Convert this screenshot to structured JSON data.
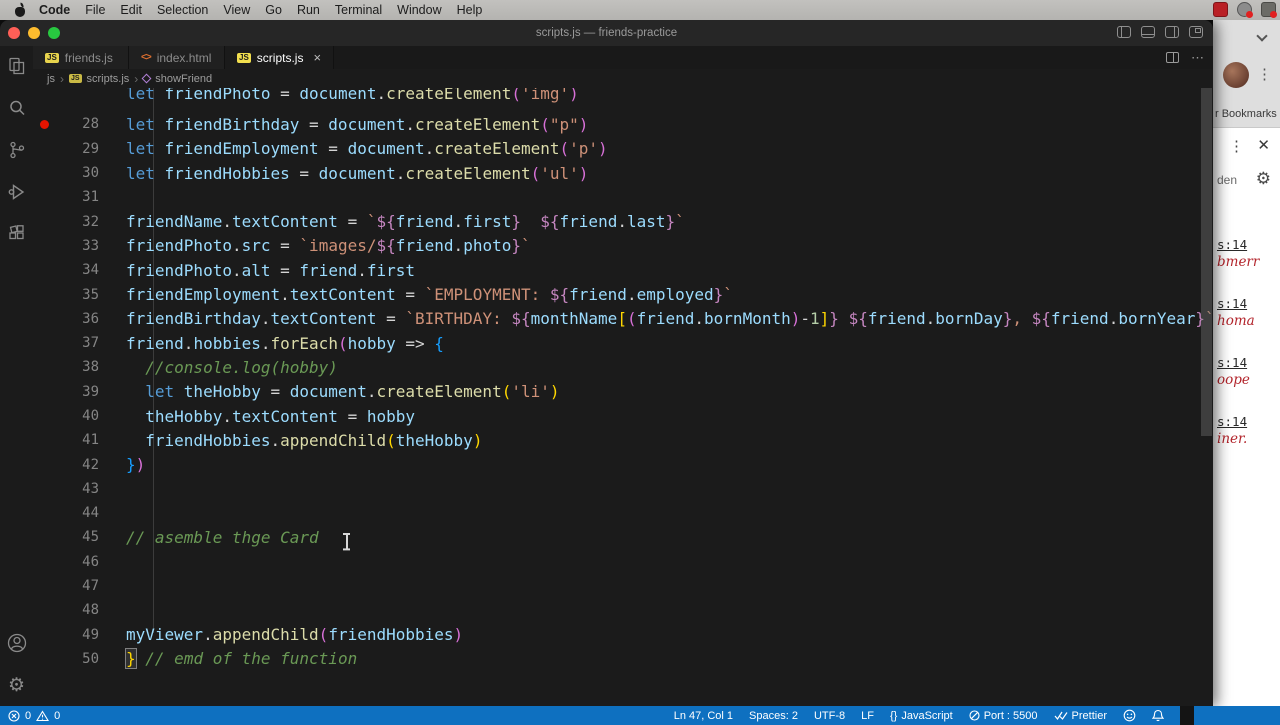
{
  "menubar": {
    "items": [
      "Code",
      "File",
      "Edit",
      "Selection",
      "View",
      "Go",
      "Run",
      "Terminal",
      "Window",
      "Help"
    ],
    "bold_item": "Code"
  },
  "window": {
    "title": "scripts.js — friends-practice"
  },
  "icons": {
    "js_badge": "JS",
    "html_badge": "<>",
    "more_glyph": "⋯",
    "gear_glyph": "⚙",
    "kebab_glyph": "⋮",
    "close_glyph": "✕",
    "tab_close_glyph": "×",
    "breadcrumb_separator": "›",
    "language_icon": "{}"
  },
  "tabs": [
    {
      "label": "friends.js",
      "icon": "js",
      "active": false
    },
    {
      "label": "index.html",
      "icon": "html",
      "active": false
    },
    {
      "label": "scripts.js",
      "icon": "js",
      "active": true,
      "closable": true
    }
  ],
  "breadcrumb": {
    "segments": [
      "js",
      "scripts.js",
      "showFriend"
    ]
  },
  "editor": {
    "partial_line": {
      "t": [
        [
          "kw",
          "let "
        ],
        [
          "var",
          "friendPhoto"
        ],
        [
          "op",
          " = "
        ],
        [
          "var",
          "document"
        ],
        [
          "op",
          "."
        ],
        [
          "fn",
          "createElement"
        ],
        [
          "b2",
          "("
        ],
        [
          "str",
          "'img'"
        ],
        [
          "b2",
          ")"
        ]
      ]
    },
    "lines": [
      {
        "n": 28,
        "bp": true,
        "t": [
          [
            "kw",
            "let "
          ],
          [
            "var",
            "friendBirthday"
          ],
          [
            "op",
            " = "
          ],
          [
            "var",
            "document"
          ],
          [
            "op",
            "."
          ],
          [
            "fn",
            "createElement"
          ],
          [
            "b2",
            "("
          ],
          [
            "str",
            "\"p\""
          ],
          [
            "b2",
            ")"
          ]
        ]
      },
      {
        "n": 29,
        "t": [
          [
            "kw",
            "let "
          ],
          [
            "var",
            "friendEmployment"
          ],
          [
            "op",
            " = "
          ],
          [
            "var",
            "document"
          ],
          [
            "op",
            "."
          ],
          [
            "fn",
            "createElement"
          ],
          [
            "b2",
            "("
          ],
          [
            "str",
            "'p'"
          ],
          [
            "b2",
            ")"
          ]
        ]
      },
      {
        "n": 30,
        "t": [
          [
            "kw",
            "let "
          ],
          [
            "var",
            "friendHobbies"
          ],
          [
            "op",
            " = "
          ],
          [
            "var",
            "document"
          ],
          [
            "op",
            "."
          ],
          [
            "fn",
            "createElement"
          ],
          [
            "b2",
            "("
          ],
          [
            "str",
            "'ul'"
          ],
          [
            "b2",
            ")"
          ]
        ]
      },
      {
        "n": 31,
        "t": []
      },
      {
        "n": 32,
        "t": [
          [
            "var",
            "friendName"
          ],
          [
            "op",
            "."
          ],
          [
            "var",
            "textContent"
          ],
          [
            "op",
            " = "
          ],
          [
            "str",
            "`"
          ],
          [
            "tpl",
            "${"
          ],
          [
            "var",
            "friend"
          ],
          [
            "op",
            "."
          ],
          [
            "var",
            "first"
          ],
          [
            "tpl",
            "}"
          ],
          [
            "str",
            "  "
          ],
          [
            "tpl",
            "${"
          ],
          [
            "var",
            "friend"
          ],
          [
            "op",
            "."
          ],
          [
            "var",
            "last"
          ],
          [
            "tpl",
            "}"
          ],
          [
            "str",
            "`"
          ]
        ]
      },
      {
        "n": 33,
        "t": [
          [
            "var",
            "friendPhoto"
          ],
          [
            "op",
            "."
          ],
          [
            "var",
            "src"
          ],
          [
            "op",
            " = "
          ],
          [
            "str",
            "`images/"
          ],
          [
            "tpl",
            "${"
          ],
          [
            "var",
            "friend"
          ],
          [
            "op",
            "."
          ],
          [
            "var",
            "photo"
          ],
          [
            "tpl",
            "}"
          ],
          [
            "str",
            "`"
          ]
        ]
      },
      {
        "n": 34,
        "t": [
          [
            "var",
            "friendPhoto"
          ],
          [
            "op",
            "."
          ],
          [
            "var",
            "alt"
          ],
          [
            "op",
            " = "
          ],
          [
            "var",
            "friend"
          ],
          [
            "op",
            "."
          ],
          [
            "var",
            "first"
          ]
        ]
      },
      {
        "n": 35,
        "t": [
          [
            "var",
            "friendEmployment"
          ],
          [
            "op",
            "."
          ],
          [
            "var",
            "textContent"
          ],
          [
            "op",
            " = "
          ],
          [
            "str",
            "`EMPLOYMENT: "
          ],
          [
            "tpl",
            "${"
          ],
          [
            "var",
            "friend"
          ],
          [
            "op",
            "."
          ],
          [
            "var",
            "employed"
          ],
          [
            "tpl",
            "}"
          ],
          [
            "str",
            "`"
          ]
        ]
      },
      {
        "n": 36,
        "t": [
          [
            "var",
            "friendBirthday"
          ],
          [
            "op",
            "."
          ],
          [
            "var",
            "textContent"
          ],
          [
            "op",
            " = "
          ],
          [
            "str",
            "`BIRTHDAY: "
          ],
          [
            "tpl",
            "${"
          ],
          [
            "var",
            "monthName"
          ],
          [
            "b1",
            "["
          ],
          [
            "b2",
            "("
          ],
          [
            "var",
            "friend"
          ],
          [
            "op",
            "."
          ],
          [
            "var",
            "bornMonth"
          ],
          [
            "b2",
            ")"
          ],
          [
            "op",
            "-"
          ],
          [
            "num",
            "1"
          ],
          [
            "b1",
            "]"
          ],
          [
            "tpl",
            "}"
          ],
          [
            "str",
            " "
          ],
          [
            "tpl",
            "${"
          ],
          [
            "var",
            "friend"
          ],
          [
            "op",
            "."
          ],
          [
            "var",
            "bornDay"
          ],
          [
            "tpl",
            "}"
          ],
          [
            "str",
            ", "
          ],
          [
            "tpl",
            "${"
          ],
          [
            "var",
            "friend"
          ],
          [
            "op",
            "."
          ],
          [
            "var",
            "bornYear"
          ],
          [
            "tpl",
            "}"
          ],
          [
            "str",
            "`"
          ]
        ]
      },
      {
        "n": 37,
        "t": [
          [
            "var",
            "friend"
          ],
          [
            "op",
            "."
          ],
          [
            "var",
            "hobbies"
          ],
          [
            "op",
            "."
          ],
          [
            "fn",
            "forEach"
          ],
          [
            "b2",
            "("
          ],
          [
            "var",
            "hobby"
          ],
          [
            "op",
            " => "
          ],
          [
            "b3",
            "{"
          ]
        ]
      },
      {
        "n": 38,
        "t": [
          [
            "op",
            "  "
          ],
          [
            "cm",
            "//console.log(hobby)"
          ]
        ]
      },
      {
        "n": 39,
        "t": [
          [
            "op",
            "  "
          ],
          [
            "kw",
            "let "
          ],
          [
            "var",
            "theHobby"
          ],
          [
            "op",
            " = "
          ],
          [
            "var",
            "document"
          ],
          [
            "op",
            "."
          ],
          [
            "fn",
            "createElement"
          ],
          [
            "b1",
            "("
          ],
          [
            "str",
            "'li'"
          ],
          [
            "b1",
            ")"
          ]
        ]
      },
      {
        "n": 40,
        "t": [
          [
            "op",
            "  "
          ],
          [
            "var",
            "theHobby"
          ],
          [
            "op",
            "."
          ],
          [
            "var",
            "textContent"
          ],
          [
            "op",
            " = "
          ],
          [
            "var",
            "hobby"
          ]
        ]
      },
      {
        "n": 41,
        "t": [
          [
            "op",
            "  "
          ],
          [
            "var",
            "friendHobbies"
          ],
          [
            "op",
            "."
          ],
          [
            "fn",
            "appendChild"
          ],
          [
            "b1",
            "("
          ],
          [
            "var",
            "theHobby"
          ],
          [
            "b1",
            ")"
          ]
        ]
      },
      {
        "n": 42,
        "t": [
          [
            "b3",
            "}"
          ],
          [
            "b2",
            ")"
          ]
        ]
      },
      {
        "n": 43,
        "t": []
      },
      {
        "n": 44,
        "t": []
      },
      {
        "n": 45,
        "t": [
          [
            "cm",
            "// asemble thge Card"
          ]
        ]
      },
      {
        "n": 46,
        "t": []
      },
      {
        "n": 47,
        "t": []
      },
      {
        "n": 48,
        "t": []
      },
      {
        "n": 49,
        "t": [
          [
            "var",
            "myViewer"
          ],
          [
            "op",
            "."
          ],
          [
            "fn",
            "appendChild"
          ],
          [
            "b2",
            "("
          ],
          [
            "var",
            "friendHobbies"
          ],
          [
            "b2",
            ")"
          ]
        ]
      },
      {
        "n": 50,
        "t": [
          [
            "b1m",
            "}"
          ],
          [
            "op",
            " "
          ],
          [
            "cm",
            "// emd of the function"
          ]
        ]
      }
    ]
  },
  "browser_panel": {
    "bookmarks_label": "r Bookmarks",
    "sub_label": "den",
    "entries": [
      {
        "size": "s:14",
        "word": "bmerr"
      },
      {
        "size": "s:14",
        "word": "homa"
      },
      {
        "size": "s:14",
        "word": "oope"
      },
      {
        "size": "s:14",
        "word": "iner."
      }
    ]
  },
  "statusbar": {
    "errors": "0",
    "warnings": "0",
    "line_col": "Ln 47, Col 1",
    "spaces": "Spaces: 2",
    "encoding": "UTF-8",
    "eol": "LF",
    "language": "JavaScript",
    "port": "Port : 5500",
    "formatter": "Prettier"
  },
  "colors": {
    "accent": "#0e70c0",
    "breakpoint": "#e51400",
    "traffic_red": "#ff5f57",
    "traffic_yellow": "#febc2e",
    "traffic_green": "#28c840"
  }
}
